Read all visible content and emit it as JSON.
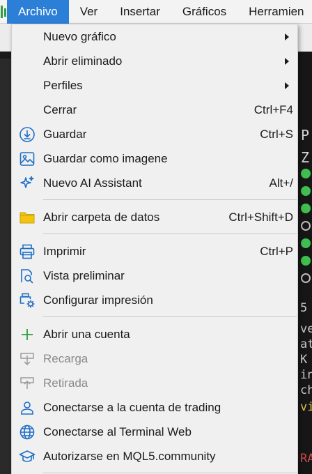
{
  "menubar": {
    "items": [
      {
        "label": "Archivo",
        "active": true
      },
      {
        "label": "Ver"
      },
      {
        "label": "Insertar"
      },
      {
        "label": "Gráficos"
      },
      {
        "label": "Herramien"
      }
    ]
  },
  "menu": {
    "items": [
      {
        "label": "Nuevo gráfico",
        "submenu": true
      },
      {
        "label": "Abrir eliminado",
        "submenu": true
      },
      {
        "label": "Perfiles",
        "submenu": true
      },
      {
        "label": "Cerrar",
        "shortcut": "Ctrl+F4"
      },
      {
        "label": "Guardar",
        "shortcut": "Ctrl+S",
        "icon": "save-icon"
      },
      {
        "label": "Guardar como imagene",
        "icon": "image-icon"
      },
      {
        "label": "Nuevo AI Assistant",
        "shortcut": "Alt+/",
        "icon": "sparkle-icon"
      },
      {
        "label": "Abrir carpeta de datos",
        "shortcut": "Ctrl+Shift+D",
        "icon": "folder-icon"
      },
      {
        "label": "Imprimir",
        "shortcut": "Ctrl+P",
        "icon": "printer-icon"
      },
      {
        "label": "Vista preliminar",
        "icon": "print-preview-icon"
      },
      {
        "label": "Configurar impresión",
        "icon": "print-settings-icon"
      },
      {
        "label": "Abrir una cuenta",
        "icon": "plus-icon"
      },
      {
        "label": "Recarga",
        "icon": "deposit-icon",
        "disabled": true
      },
      {
        "label": "Retirada",
        "icon": "withdraw-icon",
        "disabled": true
      },
      {
        "label": "Conectarse a la cuenta de trading",
        "icon": "user-icon"
      },
      {
        "label": "Conectarse al Terminal Web",
        "icon": "globe-icon"
      },
      {
        "label": "Autorizarse en MQL5.community",
        "icon": "graduation-cap-icon"
      }
    ]
  },
  "background": {
    "right_text": [
      "P",
      "Z",
      "5",
      "ve",
      "at",
      "K",
      "in",
      "ch",
      "vi",
      "RA"
    ]
  },
  "colors": {
    "accent": "#2c7fd6",
    "icon_blue": "#1f6fc5",
    "icon_green": "#2e9e3e",
    "folder": "#f2c40f",
    "disabled": "#8a8a8a"
  }
}
